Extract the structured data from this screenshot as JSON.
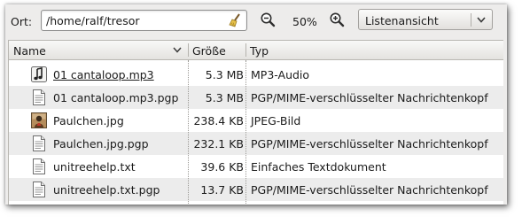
{
  "toolbar": {
    "location_label": "Ort:",
    "location_value": "/home/ralf/tresor",
    "zoom_level": "50%",
    "view_mode": "Listenansicht"
  },
  "columns": {
    "name": "Name",
    "size": "Größe",
    "type": "Typ"
  },
  "files": [
    {
      "name": "01 cantaloop.mp3",
      "size": "5.3 MB",
      "type": "MP3-Audio",
      "icon": "audio-file-icon"
    },
    {
      "name": "01 cantaloop.mp3.pgp",
      "size": "5.3 MB",
      "type": "PGP/MIME-verschlüsselter Nachrichtenkopf",
      "icon": "text-file-icon"
    },
    {
      "name": "Paulchen.jpg",
      "size": "238.4 KB",
      "type": "JPEG-Bild",
      "icon": "image-thumbnail-icon"
    },
    {
      "name": "Paulchen.jpg.pgp",
      "size": "232.1 KB",
      "type": "PGP/MIME-verschlüsselter Nachrichtenkopf",
      "icon": "text-file-icon"
    },
    {
      "name": "unitreehelp.txt",
      "size": "39.6 KB",
      "type": "Einfaches Textdokument",
      "icon": "text-file-icon"
    },
    {
      "name": "unitreehelp.txt.pgp",
      "size": "13.7 KB",
      "type": "PGP/MIME-verschlüsselter Nachrichtenkopf",
      "icon": "text-file-icon"
    }
  ]
}
